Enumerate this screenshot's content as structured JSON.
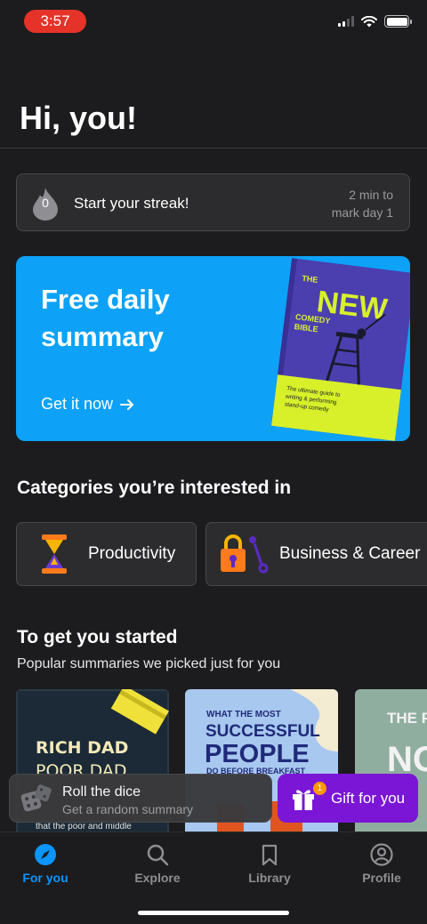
{
  "status_bar": {
    "time": "3:57",
    "time_pill_color": "#e5332a"
  },
  "greeting": "Hi, you!",
  "streak": {
    "count": "0",
    "title": "Start your streak!",
    "note_line1": "2 min to",
    "note_line2": "mark day 1"
  },
  "promo": {
    "title": "Free daily summary",
    "cta": "Get it now",
    "background": "#0da2f7",
    "book": {
      "the": "THE",
      "new": "NEW",
      "comedy": "COMEDY",
      "bible": "BIBLE",
      "tagline1": "The ultimate guide to",
      "tagline2": "writing & performing",
      "tagline3": "stand-up comedy"
    }
  },
  "categories": {
    "title": "Categories you’re interested in",
    "items": [
      {
        "label": "Productivity",
        "icon": "hourglass-icon"
      },
      {
        "label": "Business & Career",
        "icon": "padlock-key-icon"
      }
    ]
  },
  "started": {
    "title": "To get you started",
    "subtitle": "Popular summaries we picked just for you",
    "books": [
      {
        "line1": "RICH DAD",
        "line2": "POOR DAD",
        "caption": "that the poor and middle"
      },
      {
        "line0": "WHAT THE MOST",
        "line1": "SUCCESSFUL",
        "line2": "PEOPLE",
        "line3": "DO BEFORE BREAKFAST"
      },
      {
        "line1": "THE P",
        "line2": "NO"
      }
    ]
  },
  "dice": {
    "title": "Roll the dice",
    "subtitle": "Get a random summary"
  },
  "gift": {
    "label": "Gift for you",
    "badge": "1",
    "color": "#7b16d6"
  },
  "tabs": [
    {
      "label": "For you",
      "icon": "compass-icon",
      "active": true
    },
    {
      "label": "Explore",
      "icon": "search-icon",
      "active": false
    },
    {
      "label": "Library",
      "icon": "bookmark-icon",
      "active": false
    },
    {
      "label": "Profile",
      "icon": "profile-icon",
      "active": false
    }
  ],
  "accent": "#0a95ff"
}
